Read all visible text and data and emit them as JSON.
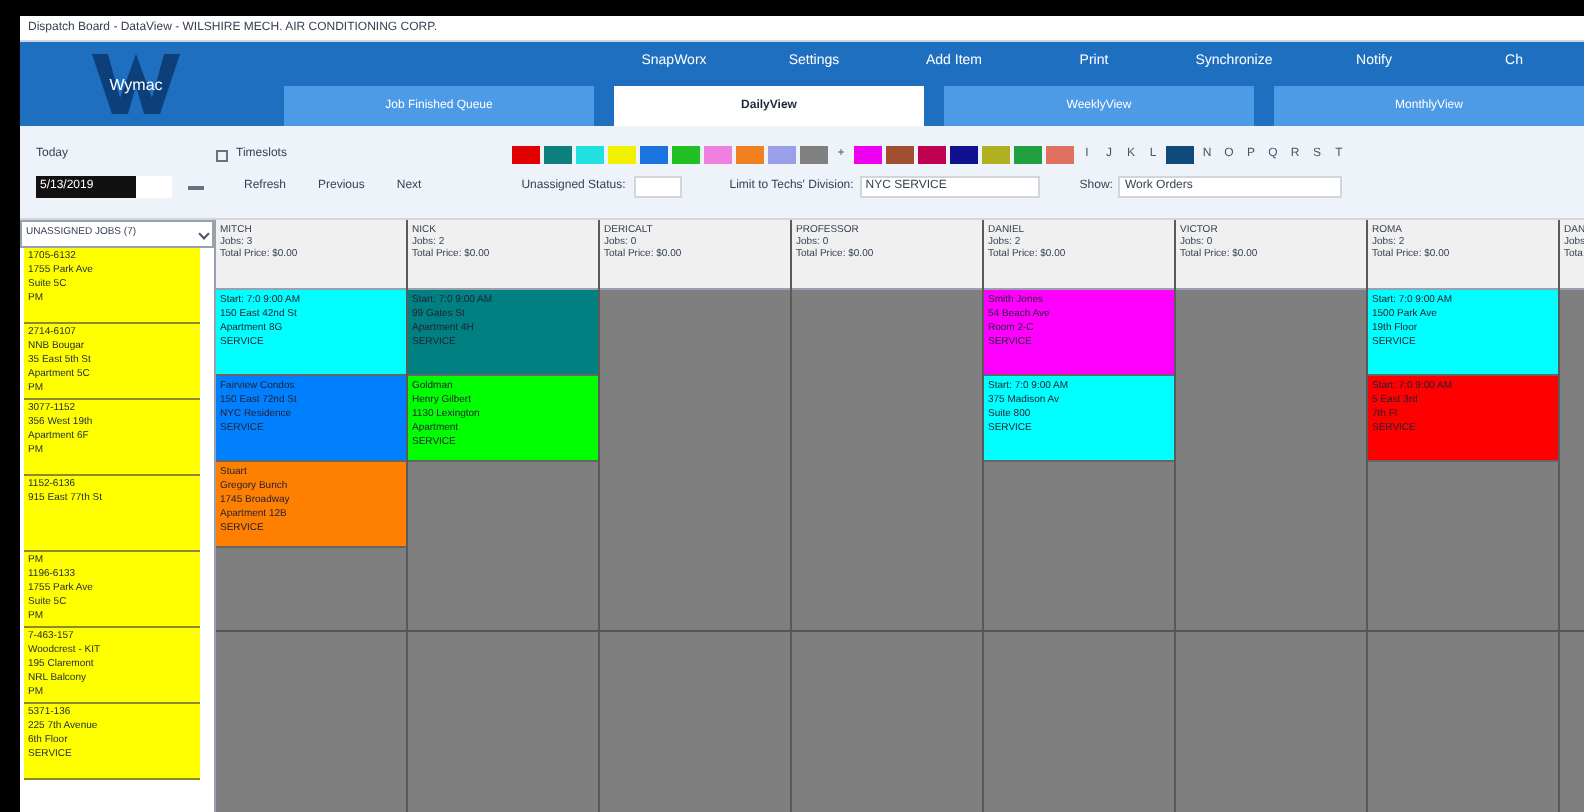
{
  "window": {
    "title": "Dispatch Board - DataView - WILSHIRE MECH. AIR CONDITIONING CORP."
  },
  "logo": {
    "text": "Wymac"
  },
  "menu": [
    {
      "label": "SnapWorx"
    },
    {
      "label": "Settings"
    },
    {
      "label": "Add Item"
    },
    {
      "label": "Print"
    },
    {
      "label": "Synchronize"
    },
    {
      "label": "Notify"
    },
    {
      "label": "Ch"
    }
  ],
  "tabs": [
    {
      "label": "Job Finished Queue",
      "selected": false
    },
    {
      "label": "DailyView",
      "selected": true
    },
    {
      "label": "WeeklyView",
      "selected": false
    },
    {
      "label": "MonthlyView",
      "selected": false
    }
  ],
  "toolbar": {
    "today": "Today",
    "timeslots": {
      "label": "Timeslots",
      "checked": false
    },
    "date": "5/13/2019",
    "refresh": "Refresh",
    "previous": "Previous",
    "next": "Next",
    "unassigned_label": "Unassigned Status:",
    "division_label": "Limit to Techs' Division:",
    "division": "NYC SERVICE",
    "show_label": "Show:",
    "show": "Work Orders"
  },
  "palette": [
    {
      "kind": "swatch",
      "color": "#e00000"
    },
    {
      "kind": "swatch",
      "color": "#0d7f7f"
    },
    {
      "kind": "swatch",
      "color": "#22e0e0"
    },
    {
      "kind": "swatch",
      "color": "#f0f000"
    },
    {
      "kind": "swatch",
      "color": "#1a74e0"
    },
    {
      "kind": "swatch",
      "color": "#22c022"
    },
    {
      "kind": "swatch",
      "color": "#f080e0"
    },
    {
      "kind": "swatch",
      "color": "#f08020"
    },
    {
      "kind": "swatch",
      "color": "#9aa0e8"
    },
    {
      "kind": "swatch",
      "color": "#808080"
    },
    {
      "kind": "letter",
      "label": "+"
    },
    {
      "kind": "swatch",
      "color": "#f000f0"
    },
    {
      "kind": "swatch",
      "color": "#a05030"
    },
    {
      "kind": "swatch",
      "color": "#c00050"
    },
    {
      "kind": "swatch",
      "color": "#101090"
    },
    {
      "kind": "swatch",
      "color": "#b0b020"
    },
    {
      "kind": "swatch",
      "color": "#20a040"
    },
    {
      "kind": "swatch",
      "color": "#e07060"
    },
    {
      "kind": "letter",
      "label": "I"
    },
    {
      "kind": "letter",
      "label": "J"
    },
    {
      "kind": "letter",
      "label": "K"
    },
    {
      "kind": "letter",
      "label": "L"
    },
    {
      "kind": "swatch",
      "color": "#104a7a"
    },
    {
      "kind": "letter",
      "label": "N"
    },
    {
      "kind": "letter",
      "label": "O"
    },
    {
      "kind": "letter",
      "label": "P"
    },
    {
      "kind": "letter",
      "label": "Q"
    },
    {
      "kind": "letter",
      "label": "R"
    },
    {
      "kind": "letter",
      "label": "S"
    },
    {
      "kind": "letter",
      "label": "T"
    }
  ],
  "unassigned": {
    "title": "UNASSIGNED JOBS (7)",
    "items": [
      {
        "lines": [
          {
            "text": "1705-6132"
          },
          {
            "text": "1755 Park Ave"
          },
          {
            "text": "Suite 5C"
          },
          {
            "text": "PM"
          }
        ]
      },
      {
        "lines": [
          {
            "text": "2714-6107"
          },
          {
            "text": "NNB Bougar"
          },
          {
            "text": "35 East 5th St"
          },
          {
            "text": "Apartment 5C"
          },
          {
            "text": "PM"
          }
        ]
      },
      {
        "lines": [
          {
            "text": "3077-1152"
          },
          {
            "text": "356 West 19th"
          },
          {
            "text": "Apartment 6F"
          },
          {
            "text": "PM"
          }
        ]
      },
      {
        "lines": [
          {
            "text": "1152-6136"
          },
          {
            "text": "915 East 77th St"
          }
        ]
      },
      {
        "lines": [
          {
            "text": "PM"
          },
          {
            "text": "1196-6133"
          },
          {
            "text": "1755 Park Ave"
          },
          {
            "text": "Suite 5C"
          },
          {
            "text": "PM"
          }
        ]
      },
      {
        "lines": [
          {
            "text": "7-463-157"
          },
          {
            "text": "Woodcrest - KIT"
          },
          {
            "text": "195 Claremont"
          },
          {
            "text": "NRL Balcony"
          },
          {
            "text": "PM"
          }
        ]
      },
      {
        "lines": [
          {
            "text": "5371-136"
          },
          {
            "text": "225 7th Avenue"
          },
          {
            "text": "6th Floor"
          },
          {
            "text": "SERVICE"
          }
        ]
      }
    ]
  },
  "technicians": [
    {
      "name": "MITCH",
      "jobs_count": "Jobs: 3",
      "total": "Total Price: $0.00",
      "jobs": [
        {
          "color": "#00ffff",
          "lines": [
            {
              "text": "Start: 7:0 9:00 AM"
            },
            {
              "text": "150 East 42nd St"
            },
            {
              "text": "Apartment 8G"
            },
            {
              "text": "SERVICE"
            }
          ]
        },
        {
          "color": "#0080ff",
          "lines": [
            {
              "text": "Fairview Condos"
            },
            {
              "text": "150 East 72nd St"
            },
            {
              "text": "NYC Residence"
            },
            {
              "text": "SERVICE"
            }
          ]
        },
        {
          "color": "#ff8000",
          "lines": [
            {
              "text": "Stuart"
            },
            {
              "text": "Gregory Bunch"
            },
            {
              "text": "1745 Broadway"
            },
            {
              "text": "Apartment 12B"
            },
            {
              "text": "SERVICE"
            }
          ]
        }
      ]
    },
    {
      "name": "NICK",
      "jobs_count": "Jobs: 2",
      "total": "Total Price: $0.00",
      "jobs": [
        {
          "color": "#008080",
          "lines": [
            {
              "text": "Start: 7:0 9:00 AM"
            },
            {
              "text": "99 Gates St"
            },
            {
              "text": "Apartment 4H"
            },
            {
              "text": "SERVICE"
            }
          ]
        },
        {
          "color": "#00ff00",
          "lines": [
            {
              "text": "Goldman"
            },
            {
              "text": "Henry Gilbert"
            },
            {
              "text": "1130 Lexington"
            },
            {
              "text": "Apartment"
            },
            {
              "text": "SERVICE"
            }
          ]
        }
      ]
    },
    {
      "name": "DERICALT",
      "jobs_count": "Jobs: 0",
      "total": "Total Price: $0.00"
    },
    {
      "name": "PROFESSOR",
      "jobs_count": "Jobs: 0",
      "total": "Total Price: $0.00"
    },
    {
      "name": "DANIEL",
      "jobs_count": "Jobs: 2",
      "total": "Total Price: $0.00",
      "jobs": [
        {
          "color": "#ff00ff",
          "lines": [
            {
              "text": "Smith Jones"
            },
            {
              "text": "54 Beach Ave"
            },
            {
              "text": "Room 2-C"
            },
            {
              "text": "SERVICE"
            }
          ]
        },
        {
          "color": "#00ffff",
          "lines": [
            {
              "text": "Start: 7:0 9:00 AM"
            },
            {
              "text": "375 Madison Av"
            },
            {
              "text": "Suite 800"
            },
            {
              "text": "SERVICE"
            }
          ]
        }
      ]
    },
    {
      "name": "VICTOR",
      "jobs_count": "Jobs: 0",
      "total": "Total Price: $0.00"
    },
    {
      "name": "ROMA",
      "jobs_count": "Jobs: 2",
      "total": "Total Price: $0.00",
      "jobs": [
        {
          "color": "#00ffff",
          "lines": [
            {
              "text": "Start: 7:0 9:00 AM"
            },
            {
              "text": "1500 Park Ave"
            },
            {
              "text": "19th Floor"
            },
            {
              "text": "SERVICE"
            }
          ]
        },
        {
          "color": "#ff0000",
          "lines": [
            {
              "text": "Start: 7:0 9:00 AM"
            },
            {
              "text": "5 East 3rd"
            },
            {
              "text": "7th Fl"
            },
            {
              "text": "SERVICE"
            }
          ]
        }
      ]
    },
    {
      "name": "DAN",
      "jobs_count": "Jobs",
      "total": "Tota"
    }
  ]
}
